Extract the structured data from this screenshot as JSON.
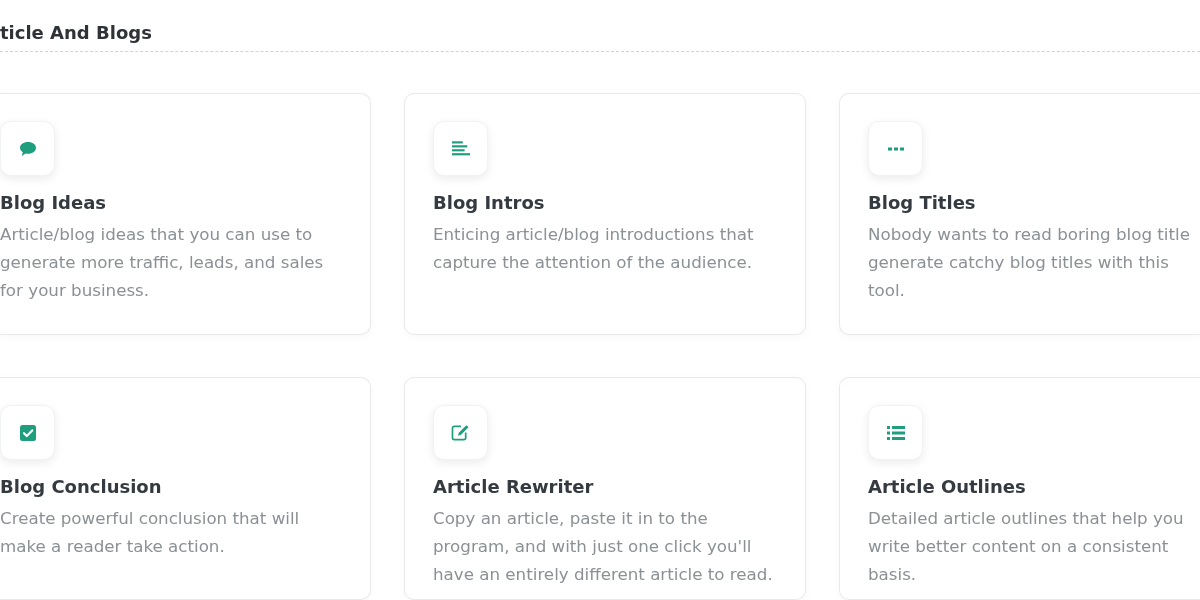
{
  "section": {
    "title": "ticle And Blogs"
  },
  "tools": [
    {
      "title": "Blog Ideas",
      "description": "Article/blog ideas that you can use to generate more traffic, leads, and sales for your business."
    },
    {
      "title": "Blog Intros",
      "description": "Enticing article/blog introductions that capture the attention of the audience."
    },
    {
      "title": "Blog Titles",
      "description": "Nobody wants to read boring blog title generate catchy blog titles with this tool."
    },
    {
      "title": "Blog Conclusion",
      "description": "Create powerful conclusion that will make a reader take action."
    },
    {
      "title": "Article Rewriter",
      "description": "Copy an article, paste it in to the program, and with just one click you'll have an entirely different article to read."
    },
    {
      "title": "Article Outlines",
      "description": "Detailed article outlines that help you write better content on a consistent basis."
    }
  ]
}
